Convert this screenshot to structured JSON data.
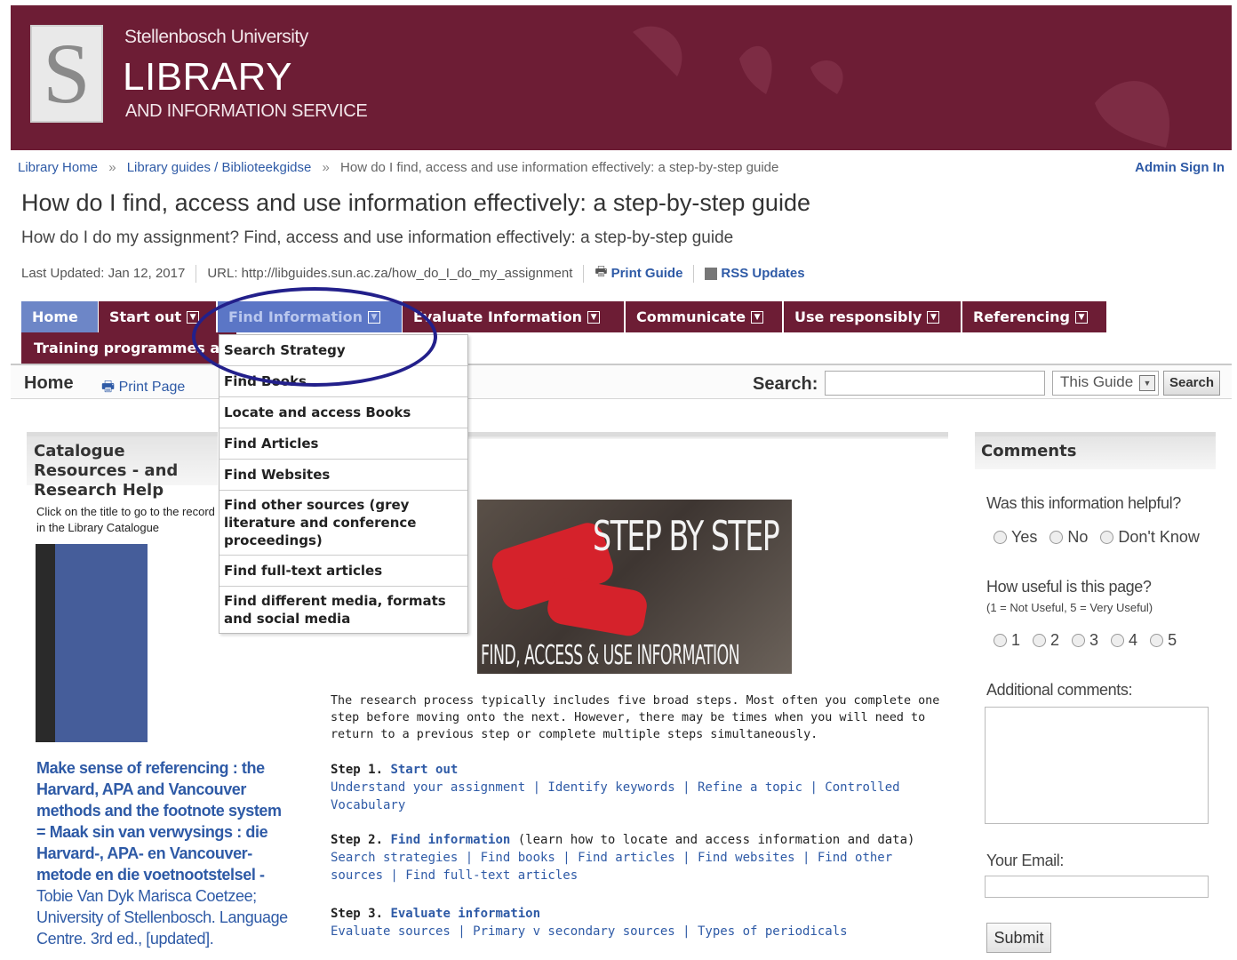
{
  "header": {
    "university": "Stellenbosch University",
    "library": "LIBRARY",
    "subtitle": "AND INFORMATION SERVICE",
    "logo_letter": "S"
  },
  "breadcrumb": {
    "items": [
      "Library Home",
      "Library guides / Biblioteekgidse"
    ],
    "current": "How do I find, access and use information effectively: a step-by-step guide",
    "separator": "»",
    "admin": "Admin Sign In"
  },
  "guide": {
    "title": "How do I find, access and use information effectively: a step-by-step guide",
    "description": "How do I do my assignment? Find, access and use information effectively: a step-by-step guide",
    "last_updated": "Last Updated: Jan 12, 2017",
    "url": "URL: http://libguides.sun.ac.za/how_do_I_do_my_assignment",
    "print_guide": "Print Guide",
    "rss": "RSS Updates"
  },
  "tabs": {
    "home": "Home",
    "start_out": "Start out",
    "find_information": "Find Information",
    "evaluate": "Evaluate Information",
    "communicate": "Communicate",
    "use_responsibly": "Use responsibly",
    "referencing": "Referencing",
    "training": "Training programmes a"
  },
  "dropdown": {
    "items": [
      "Search Strategy",
      "Find Books",
      "Locate and access Books",
      "Find Articles",
      "Find Websites",
      "Find other sources (grey literature and conference proceedings)",
      "Find full-text articles",
      "Find different media, formats and social media"
    ]
  },
  "subnav": {
    "home": "Home",
    "print_page": "Print Page",
    "search_label": "Search:",
    "search_value": "",
    "scope": "This Guide",
    "search_button": "Search"
  },
  "left": {
    "heading": "Catalogue Resources - and Research Help",
    "intro": "Click on the title to go to the record in the Library Catalogue",
    "book_title": "Make sense of referencing : the Harvard, APA and Vancouver methods and the footnote system = Maak sin van verwysings : die Harvard-, APA- en Vancouver-metode en die voetnootstelsel -",
    "book_author": "Tobie Van Dyk Marisca Coetzee; University of Stellenbosch. Language Centre. 3rd ed., [updated]."
  },
  "main": {
    "hero_title": "STEP BY STEP",
    "hero_sub": "FIND, ACCESS & USE INFORMATION",
    "intro": "The research process typically includes five broad steps. Most often you complete one step before moving onto the next. However, there may be times when you will need to return to a previous step or complete multiple steps simultaneously.",
    "step1_label": "Step 1.",
    "step1_title": "Start out",
    "step1_links": "Understand your assignment  | Identify keywords | Refine a topic | Controlled Vocabulary",
    "step2_label": "Step 2.",
    "step2_title": "Find information",
    "step2_note": " (learn how to locate and access information and data)",
    "step2_links": "Search strategies | Find books | Find articles | Find websites | Find other sources | Find full-text articles",
    "step3_label": "Step 3.",
    "step3_title": "Evaluate information",
    "step3_links": "Evaluate sources | Primary v secondary sources | Types of periodicals"
  },
  "comments": {
    "heading": "Comments",
    "q1": "Was this information helpful?",
    "q1_options": [
      "Yes",
      "No",
      "Don't Know"
    ],
    "q2": "How useful is this page?",
    "q2_scale": "(1 = Not Useful, 5 = Very Useful)",
    "q2_options": [
      "1",
      "2",
      "3",
      "4",
      "5"
    ],
    "q3": "Additional comments:",
    "email_label": "Your Email:",
    "submit": "Submit"
  },
  "colors": {
    "brand": "#6d1d35",
    "link": "#2e5aa6",
    "tab_active": "#5b76c6",
    "highlight_ellipse": "#23208b"
  }
}
